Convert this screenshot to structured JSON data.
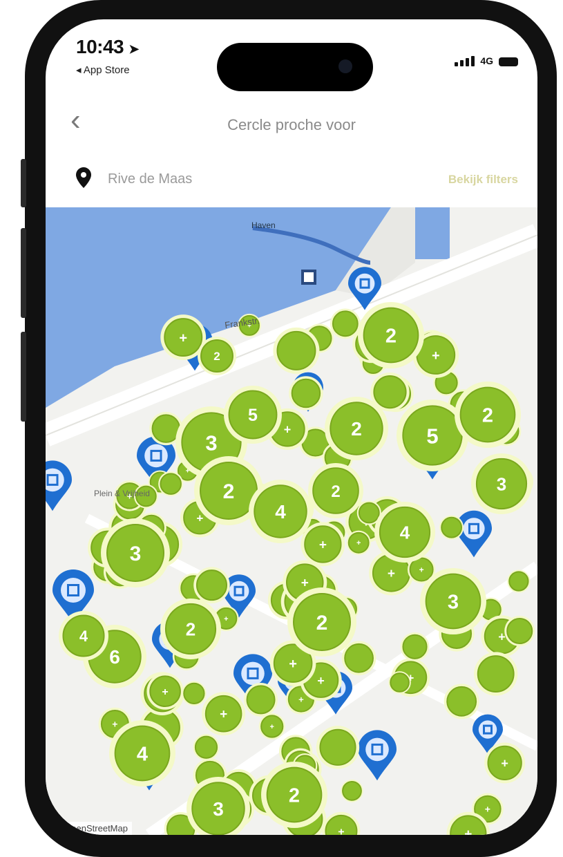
{
  "status_bar": {
    "time": "10:43",
    "back_app": "◂ App Store",
    "network": "4G"
  },
  "header": {
    "title": "Cercle proche voor",
    "back_icon": "chevron-left-icon"
  },
  "location_bar": {
    "icon": "map-pin-icon",
    "label": "Rive de Maas",
    "action": "Bekijk filters"
  },
  "map": {
    "water_label": "Haven",
    "street_label": "Frankstr.",
    "poi_label": "Plein & Vrijheid",
    "attribution": "© OpenStreetMap",
    "colors": {
      "water": "#7fa8e3",
      "land": "#f2f2ef",
      "cluster_fill": "#8bbf2a",
      "cluster_ring": "#f4f9c8",
      "marker_blue": "#1f6fd1"
    },
    "cluster_labels": [
      "2",
      "3",
      "2",
      "4",
      "5",
      "2",
      "3",
      "2",
      "6",
      "2",
      "3",
      "4"
    ]
  },
  "colors": {
    "accent": "#8bbf2a",
    "link": "#d8d6a0"
  }
}
